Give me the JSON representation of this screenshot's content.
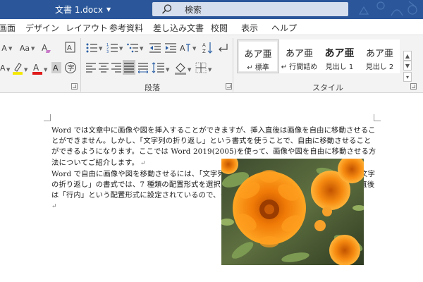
{
  "titlebar": {
    "doc_title": "文書 1.docx",
    "search_placeholder": "検索",
    "accent": "#2b579a"
  },
  "tabs": [
    "画面",
    "デザイン",
    "レイアウト",
    "参考資料",
    "差し込み文書",
    "校閲",
    "表示",
    "ヘルプ"
  ],
  "ribbon": {
    "font_size_label": "Aa",
    "group_paragraph": "段落",
    "group_styles": "スタイル",
    "styles": [
      {
        "sample": "あア亜",
        "name": "↵ 標準",
        "selected": true
      },
      {
        "sample": "あア亜",
        "name": "↵ 行間詰め",
        "selected": false
      },
      {
        "sample": "あア亜",
        "name": "見出し 1",
        "selected": false
      },
      {
        "sample": "あア亜",
        "name": "見出し 2",
        "selected": false
      }
    ]
  },
  "document": {
    "para1": "Word では文章中に画像や図を挿入することができますが、挿入直後は画像を自由に移動させることができません。しかし、「文字列の折り返し」という書式を使うことで、自由に移動させることができるようになります。ここでは Word 2019(2005)を使って、画像や図を自由に移動させる方法についてご紹介します。",
    "para2": "Word で自由に画像や図を移動させるには、「文字列の折り返し」という書式を使用します。「文字の折り返し」の書式では、7 種類の配置形式を選択することができます。画像や図を挿入した直後は「行内」という配置形式に設定されているので、それ以外の配置形式を選択します。",
    "para_mark": "↵"
  },
  "image": {
    "subject": "orange marigold flowers"
  }
}
